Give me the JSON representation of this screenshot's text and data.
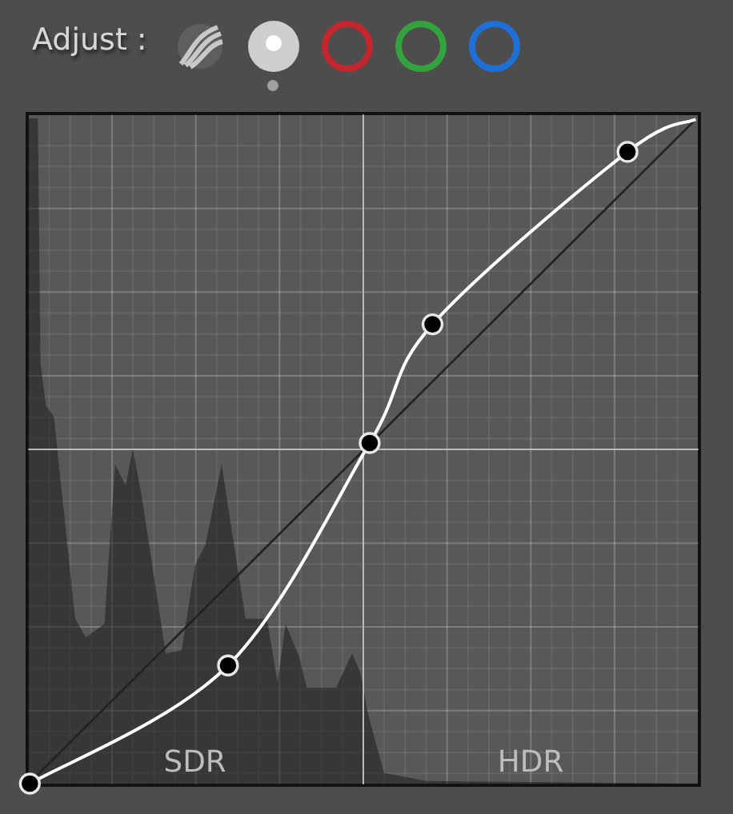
{
  "toolbar": {
    "label": "Adjust :",
    "channels": [
      {
        "kind": "luminance",
        "selected": false
      },
      {
        "kind": "rgb",
        "selected": true
      },
      {
        "kind": "ring",
        "color": "#c4262e",
        "selected": false
      },
      {
        "kind": "ring",
        "color": "#33a33d",
        "selected": false
      },
      {
        "kind": "ring",
        "color": "#1e6fd6",
        "selected": false
      }
    ]
  },
  "curve": {
    "zones": [
      "SDR",
      "HDR"
    ]
  }
}
